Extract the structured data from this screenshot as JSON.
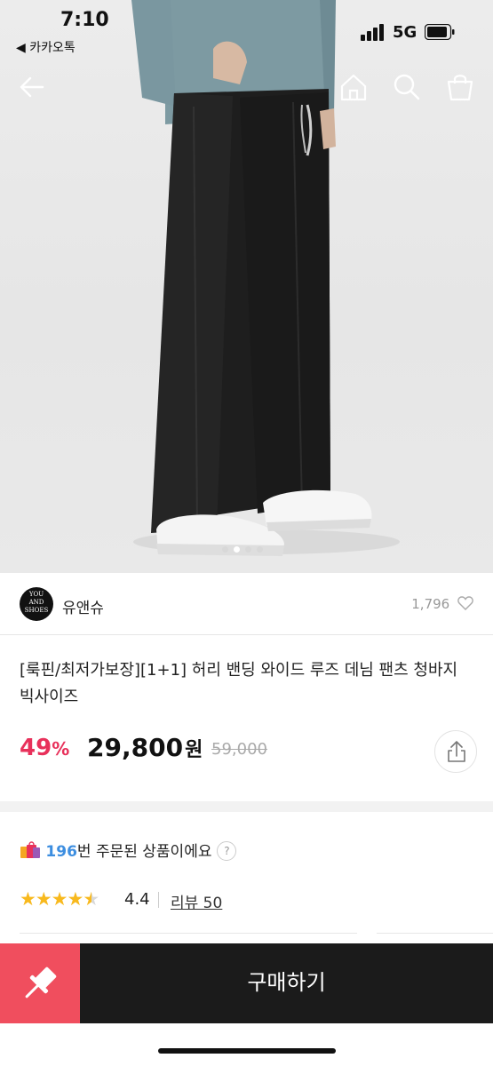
{
  "status_bar": {
    "time": "7:10",
    "back_app": "◀ 카카오톡",
    "network": "5G"
  },
  "nav": {
    "icons": [
      "back-arrow-icon",
      "home-icon",
      "search-icon",
      "shopping-bag-icon"
    ]
  },
  "gallery": {
    "pages": 4,
    "active_page": 1
  },
  "seller": {
    "logo_text": "YOU AND SHOES",
    "name": "유앤슈",
    "likes": "1,796"
  },
  "product": {
    "title": "[룩핀/최저가보장][1+1] 허리 밴딩 와이드 루즈 데님 팬츠 청바지 빅사이즈",
    "discount": "49",
    "discount_unit": "%",
    "price": "29,800",
    "price_unit": "원",
    "original_price": "59,000"
  },
  "orders": {
    "count": "196",
    "text": "번 주문된 상품이에요",
    "help": "?"
  },
  "rating": {
    "score": "4.4",
    "stars": 4.4,
    "review_label": "리뷰 50"
  },
  "actions": {
    "buy_label": "구매하기"
  },
  "colors": {
    "accent": "#e8315b",
    "pin_button": "#f04e5e",
    "buy_button": "#1b1b1b",
    "star": "#f8b91d",
    "order_count": "#3d8ee0"
  }
}
